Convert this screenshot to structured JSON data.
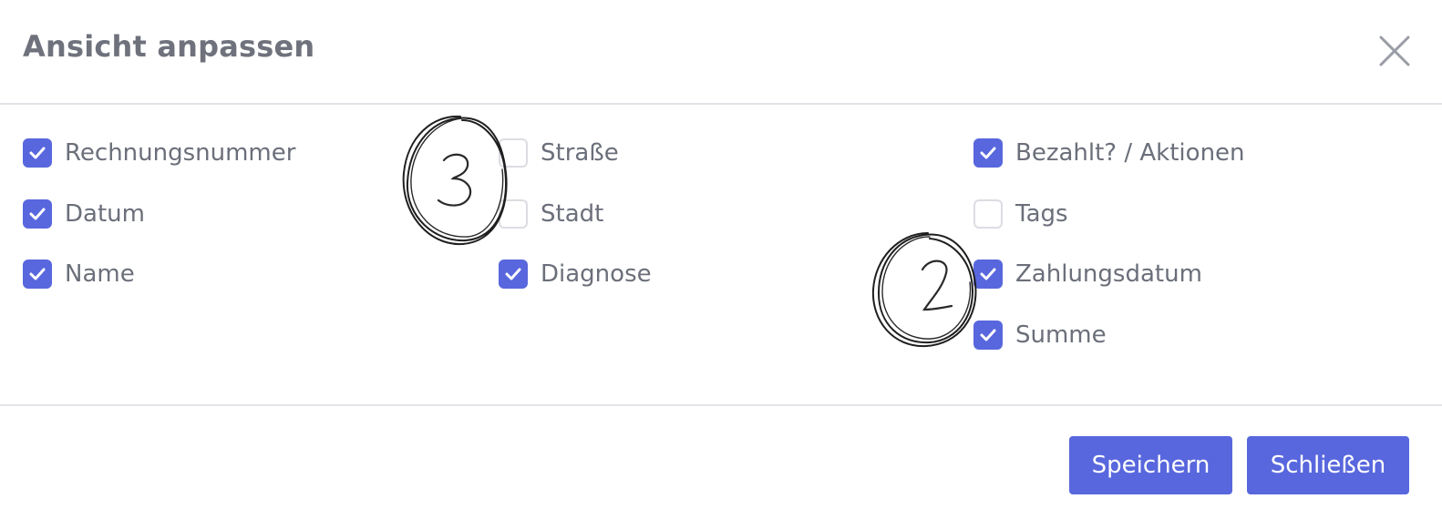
{
  "dialog": {
    "title": "Ansicht anpassen",
    "close_icon": "close-icon"
  },
  "columns": [
    {
      "items": [
        {
          "label": "Rechnungsnummer",
          "checked": true
        },
        {
          "label": "Datum",
          "checked": true
        },
        {
          "label": "Name",
          "checked": true
        }
      ]
    },
    {
      "items": [
        {
          "label": "Straße",
          "checked": false
        },
        {
          "label": "Stadt",
          "checked": false
        },
        {
          "label": "Diagnose",
          "checked": true
        }
      ]
    },
    {
      "items": [
        {
          "label": "Bezahlt? / Aktionen",
          "checked": true
        },
        {
          "label": "Tags",
          "checked": false
        },
        {
          "label": "Zahlungsdatum",
          "checked": true
        },
        {
          "label": "Summe",
          "checked": true
        }
      ]
    }
  ],
  "footer": {
    "save_label": "Speichern",
    "close_label": "Schließen"
  },
  "annotations": [
    {
      "text": "3"
    },
    {
      "text": "2"
    }
  ],
  "colors": {
    "accent": "#5867dd",
    "text": "#6b6f7a",
    "divider": "#e3e4e8"
  }
}
